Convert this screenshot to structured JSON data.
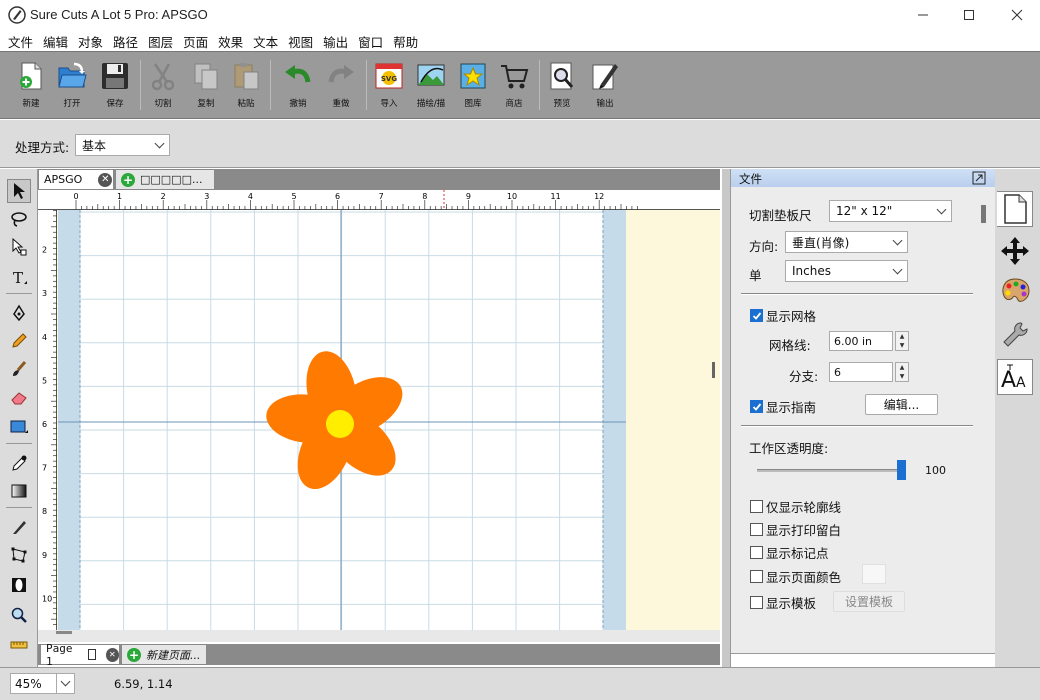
{
  "window": {
    "title": "Sure Cuts A Lot 5 Pro: APSGO",
    "minimize_icon": "minimize-icon",
    "maximize_icon": "maximize-icon",
    "close_icon": "close-icon"
  },
  "menu": [
    "文件",
    "编辑",
    "对象",
    "路径",
    "图层",
    "页面",
    "效果",
    "文本",
    "视图",
    "输出",
    "窗口",
    "帮助"
  ],
  "toolbar": {
    "buttons": [
      {
        "label": "新建",
        "icon": "new-document-icon"
      },
      {
        "label": "打开",
        "icon": "open-folder-icon"
      },
      {
        "label": "保存",
        "icon": "save-disk-icon"
      },
      {
        "label": "切割",
        "icon": "scissors-icon"
      },
      {
        "label": "复制",
        "icon": "copy-icon"
      },
      {
        "label": "粘贴",
        "icon": "paste-icon"
      },
      {
        "label": "撤销",
        "icon": "undo-icon"
      },
      {
        "label": "重做",
        "icon": "redo-icon"
      },
      {
        "label": "导入",
        "icon": "import-svg-icon"
      },
      {
        "label": "描绘/描",
        "icon": "trace-image-icon"
      },
      {
        "label": "图库",
        "icon": "library-star-icon"
      },
      {
        "label": "商店",
        "icon": "shopping-cart-icon"
      },
      {
        "label": "预览",
        "icon": "preview-magnifier-icon"
      },
      {
        "label": "输出",
        "icon": "output-pen-icon"
      }
    ]
  },
  "processing": {
    "label": "处理方式:",
    "value": "基本"
  },
  "doc_tabs": [
    {
      "label": "APSGO"
    },
    {
      "label": "□□□□□..."
    }
  ],
  "page_tabs": [
    {
      "label": "Page 1"
    },
    {
      "label": "新建页面..."
    }
  ],
  "ruler": {
    "top": [
      "0",
      "1",
      "2",
      "3",
      "4",
      "5",
      "6",
      "7",
      "8",
      "9",
      "10",
      "11",
      "12"
    ],
    "left": [
      "1",
      "2",
      "3",
      "4",
      "5",
      "6",
      "7",
      "8",
      "9",
      "10"
    ]
  },
  "panel": {
    "header": "文件",
    "mat_label": "切割垫板尺",
    "mat_value": "12\" x 12\"",
    "orientation_label": "方向:",
    "orientation_value": "垂直(肖像)",
    "unit_label": "单",
    "unit_value": "Inches",
    "show_grid_label": "显示网格",
    "show_grid_checked": true,
    "grid_lines_label": "网格线:",
    "grid_lines_value": "6.00 in",
    "subdiv_label": "分支:",
    "subdiv_value": "6",
    "show_guides_label": "显示指南",
    "show_guides_checked": true,
    "edit_button": "编辑...",
    "opacity_label": "工作区透明度:",
    "opacity_value": "100",
    "opacity_fraction": 1.0,
    "outline_label": "仅显示轮廓线",
    "print_margin_label": "显示打印留白",
    "registration_label": "显示标记点",
    "page_color_label": "显示页面颜色",
    "template_label": "显示模板",
    "template_button": "设置模板"
  },
  "status": {
    "zoom": "45%",
    "coords": "6.59, 1.14"
  },
  "colors": {
    "petal": "#ff7a00",
    "center": "#ffee00",
    "grid": "#c8dbe6",
    "margin": "#c0d8e8",
    "workspace": "#fdf7dc"
  }
}
